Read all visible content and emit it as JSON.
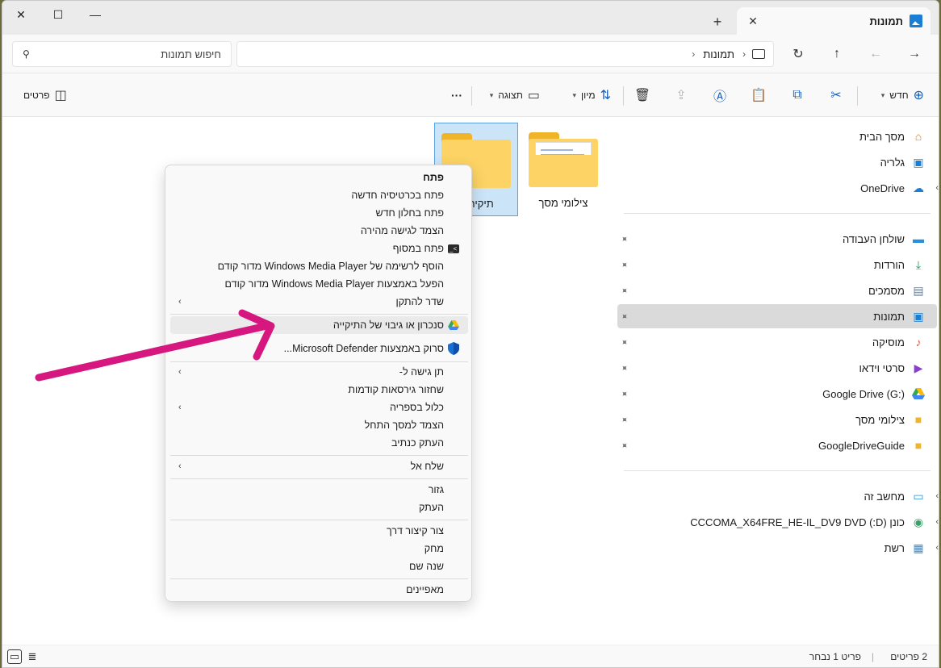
{
  "window": {
    "tab_title": "תמונות",
    "new_tab": "+",
    "close_tab": "✕",
    "minimize": "—",
    "maximize": "☐",
    "close": "✕"
  },
  "address": {
    "path": [
      "תמונות"
    ],
    "search_placeholder": "חיפוש תמונות"
  },
  "toolbar": {
    "new_label": "חדש",
    "sort_label": "מיון",
    "view_label": "תצוגה",
    "more_label": "···",
    "details_label": "פרטים"
  },
  "sidebar": {
    "top_items": [
      {
        "label": "מסך הבית",
        "icon": "home-icon"
      },
      {
        "label": "גלריה",
        "icon": "gallery-icon"
      },
      {
        "label": "OneDrive",
        "icon": "cloud-icon"
      }
    ],
    "pinned_items": [
      {
        "label": "שולחן העבודה",
        "icon": "desktop-icon"
      },
      {
        "label": "הורדות",
        "icon": "download-icon"
      },
      {
        "label": "מסמכים",
        "icon": "documents-icon"
      },
      {
        "label": "תמונות",
        "icon": "pictures-icon"
      },
      {
        "label": "מוסיקה",
        "icon": "music-icon"
      },
      {
        "label": "סרטי וידאו",
        "icon": "video-icon"
      },
      {
        "label": "Google Drive (G:)",
        "icon": "google-drive-icon"
      },
      {
        "label": "צילומי מסך",
        "icon": "folder-icon"
      },
      {
        "label": "GoogleDriveGuide",
        "icon": "folder-icon"
      }
    ],
    "bottom_items": [
      {
        "label": "מחשב זה",
        "icon": "computer-icon"
      },
      {
        "label": "כונן (D:) CCCOMA_X64FRE_HE-IL_DV9 DVD",
        "icon": "dvd-drive-icon"
      },
      {
        "label": "רשת",
        "icon": "network-icon"
      }
    ]
  },
  "content": {
    "folders": [
      {
        "label": "צילומי מסך"
      },
      {
        "label": "תיקיה ח"
      }
    ]
  },
  "context_menu": {
    "group1": [
      {
        "label": "פתח"
      },
      {
        "label": "פתח בכרטיסיה חדשה"
      },
      {
        "label": "פתח בחלון חדש"
      },
      {
        "label": "הצמד לגישה מהירה"
      },
      {
        "label": "פתח במסוף"
      },
      {
        "label": "הוסף לרשימה של Windows Media Player מדור קודם"
      },
      {
        "label": "הפעל באמצעות Windows Media Player מדור קודם"
      },
      {
        "label": "שדר להתקן"
      }
    ],
    "group2": [
      {
        "label": "סנכרון או גיבוי של התיקייה"
      },
      {
        "label": "סרוק באמצעות Microsoft Defender..."
      }
    ],
    "group3": [
      {
        "label": "תן גישה ל-"
      },
      {
        "label": "שחזור גירסאות קודמות"
      },
      {
        "label": "כלול בספריה"
      },
      {
        "label": "הצמד למסך התחל"
      },
      {
        "label": "העתק כנתיב"
      }
    ],
    "group4": [
      {
        "label": "שלח אל"
      }
    ],
    "group5": [
      {
        "label": "גזור"
      },
      {
        "label": "העתק"
      }
    ],
    "group6": [
      {
        "label": "צור קיצור דרך"
      },
      {
        "label": "מחק"
      },
      {
        "label": "שנה שם"
      }
    ],
    "group7": [
      {
        "label": "מאפיינים"
      }
    ]
  },
  "status": {
    "item_count": "2 פריטים",
    "selected": "פריט 1 נבחר"
  },
  "colors": {
    "accent": "#1a5fb4",
    "arrow": "#d6177f",
    "folder": "#fcd364",
    "selection": "#cce4f7"
  }
}
